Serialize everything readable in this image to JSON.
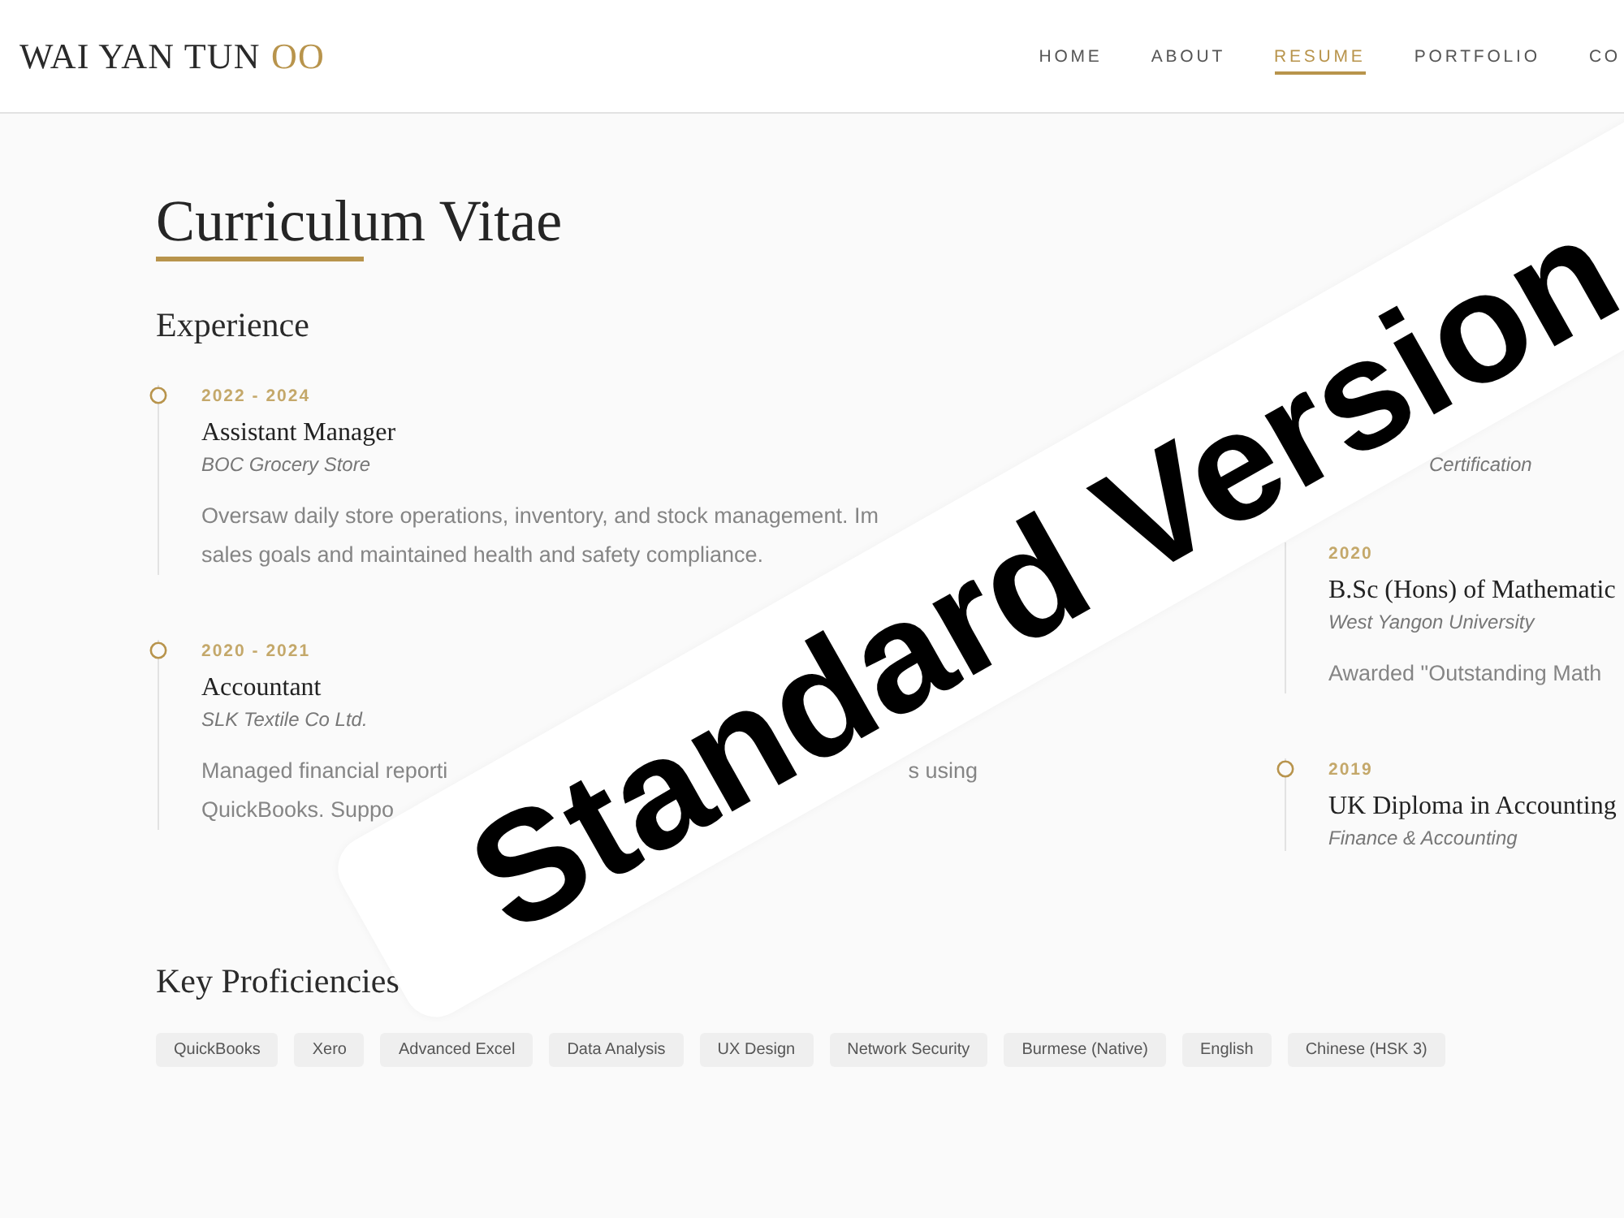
{
  "site": {
    "logo": {
      "name": "WAI YAN TUN",
      "accent": "OO"
    },
    "nav": [
      {
        "label": "HOME",
        "selected": false
      },
      {
        "label": "ABOUT",
        "selected": false
      },
      {
        "label": "RESUME",
        "selected": true
      },
      {
        "label": "PORTFOLIO",
        "selected": false
      },
      {
        "label": "CO",
        "selected": false
      }
    ]
  },
  "page_title": "Curriculum Vitae",
  "experience": {
    "heading": "Experience",
    "items": [
      {
        "marker": true,
        "year": "2022 - 2024",
        "title": "Assistant Manager",
        "subtitle": "BOC Grocery Store",
        "lines": [
          [
            "Oversaw daily store operations, inventory, and stock management. Im"
          ],
          [
            "sales goals and maintained health and safety compliance."
          ]
        ]
      },
      {
        "marker": true,
        "year": "2020 - 2021",
        "title": "Accountant",
        "subtitle": "SLK Textile Co Ltd.",
        "lines": [
          [
            "Managed financial reporti",
            "s using"
          ],
          [
            "QuickBooks. Suppo"
          ]
        ]
      }
    ]
  },
  "education": {
    "items": [
      {
        "marker": false,
        "subtitle": "Certification"
      },
      {
        "marker": false,
        "year": "2020",
        "title": "B.Sc (Hons) of Mathematic",
        "subtitle": "West Yangon University",
        "lines": [
          [
            "Awarded \"Outstanding Math"
          ]
        ]
      },
      {
        "marker": true,
        "year": "2019",
        "title": "UK Diploma in Accounting",
        "subtitle": "Finance & Accounting"
      }
    ]
  },
  "proficiencies": {
    "heading": "Key Proficiencies",
    "tags": [
      "QuickBooks",
      "Xero",
      "Advanced Excel",
      "Data Analysis",
      "UX Design",
      "Network Security",
      "Burmese (Native)",
      "English",
      "Chinese (HSK 3)"
    ]
  },
  "banner": {
    "text": "Standard Version"
  }
}
